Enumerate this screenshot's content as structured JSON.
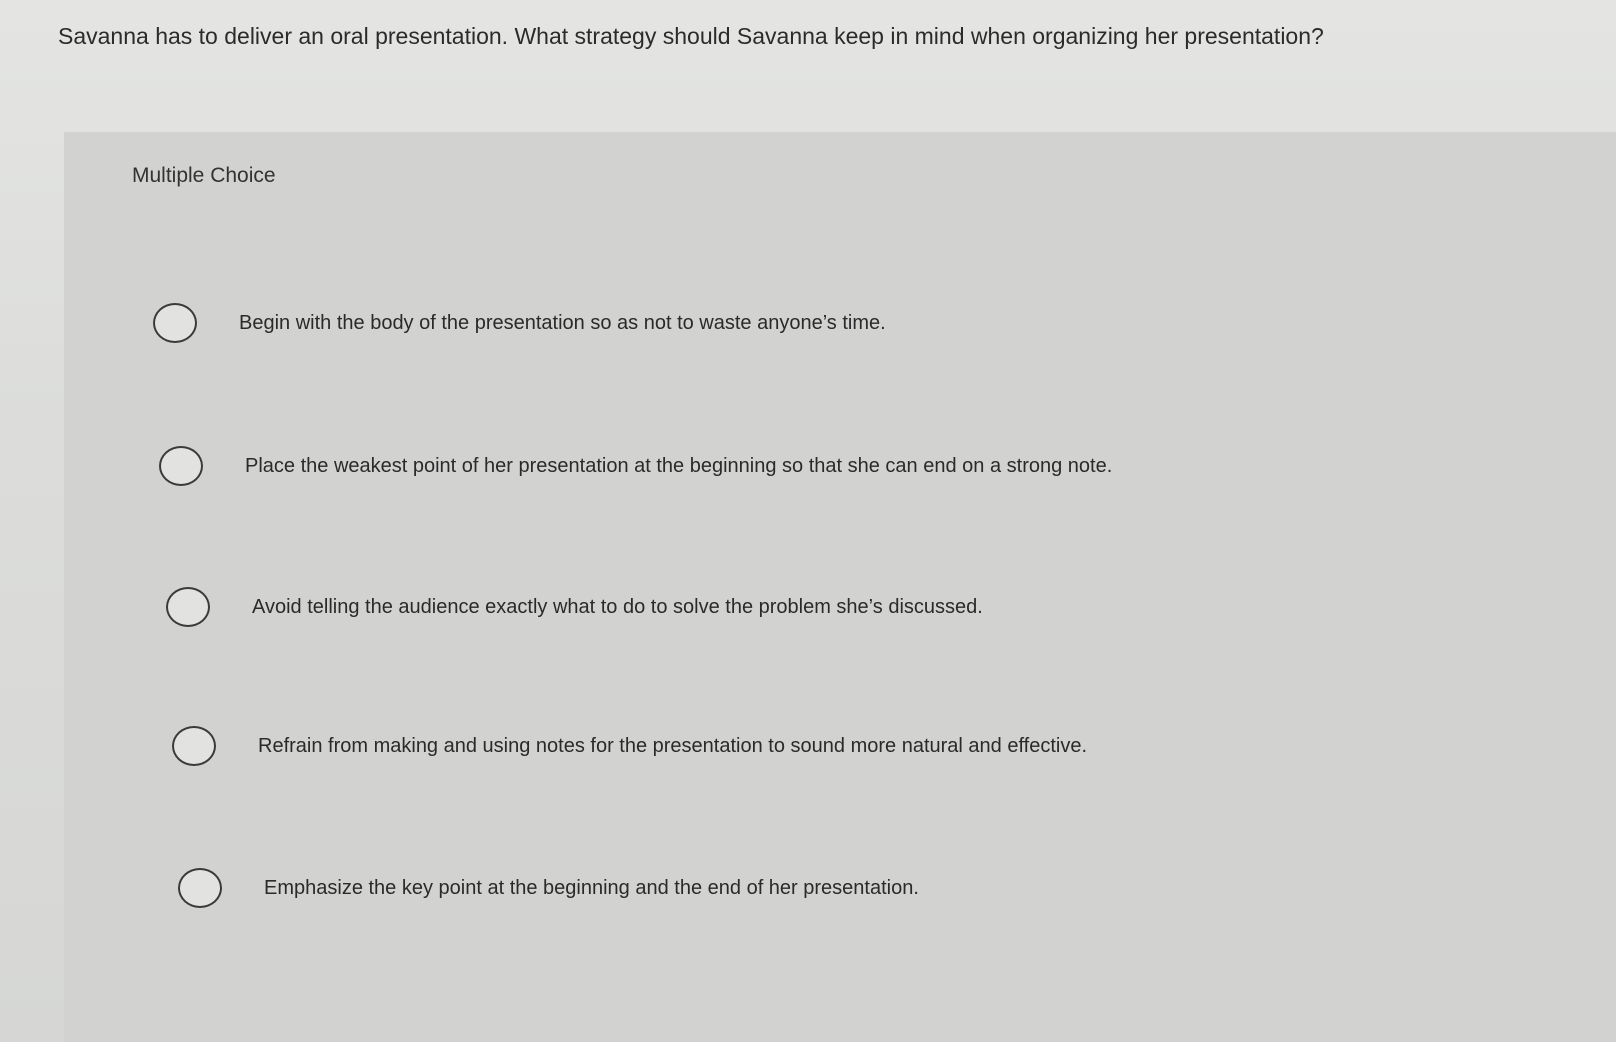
{
  "question": {
    "text": "Savanna has to deliver an oral presentation. What strategy should Savanna keep in mind when organizing her presentation?"
  },
  "panel": {
    "label": "Multiple Choice"
  },
  "choices": [
    {
      "text": "Begin with the body of the presentation so as not to waste anyone’s time."
    },
    {
      "text": "Place the weakest point of her presentation at the beginning so that she can end on a strong note."
    },
    {
      "text": "Avoid telling the audience exactly what to do to solve the problem she’s discussed."
    },
    {
      "text": "Refrain from making and using notes for the presentation to sound more natural and effective."
    },
    {
      "text": "Emphasize the key point at the beginning and the end of her presentation."
    }
  ]
}
